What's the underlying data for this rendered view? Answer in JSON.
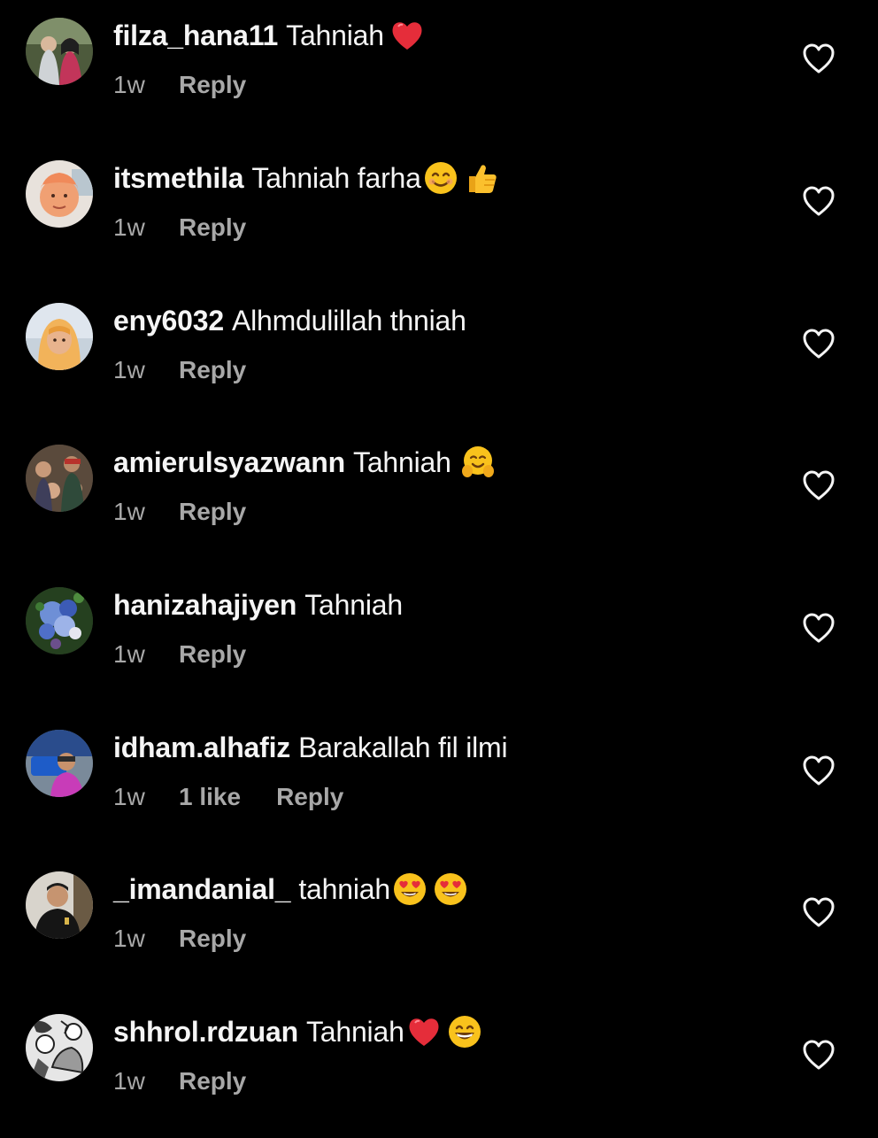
{
  "comments": [
    {
      "username": "filza_hana11",
      "text": "Tahniah",
      "emojis": [
        "red-heart"
      ],
      "time": "1w",
      "likes": "",
      "reply": "Reply"
    },
    {
      "username": "itsmethila",
      "text": "Tahniah farha",
      "emojis": [
        "smiling-face",
        "thumbs-up"
      ],
      "time": "1w",
      "likes": "",
      "reply": "Reply"
    },
    {
      "username": "eny6032",
      "text": "Alhmdulillah thniah",
      "emojis": [],
      "time": "1w",
      "likes": "",
      "reply": "Reply"
    },
    {
      "username": "amierulsyazwann",
      "text": "Tahniah",
      "emojis": [
        "hugging-face"
      ],
      "time": "1w",
      "likes": "",
      "reply": "Reply"
    },
    {
      "username": "hanizahajiyen",
      "text": "Tahniah",
      "emojis": [],
      "time": "1w",
      "likes": "",
      "reply": "Reply"
    },
    {
      "username": "idham.alhafiz",
      "text": "Barakallah fil ilmi",
      "emojis": [],
      "time": "1w",
      "likes": "1 like",
      "reply": "Reply"
    },
    {
      "username": "_imandanial_",
      "text": "tahniah",
      "emojis": [
        "heart-eyes",
        "heart-eyes"
      ],
      "time": "1w",
      "likes": "",
      "reply": "Reply"
    },
    {
      "username": "shhrol.rdzuan",
      "text": "Tahniah",
      "emojis": [
        "red-heart",
        "grinning-face"
      ],
      "time": "1w",
      "likes": "",
      "reply": "Reply"
    }
  ],
  "colors": {
    "background": "#000000",
    "primary_text": "#f5f5f5",
    "secondary_text": "#a8a8a8"
  }
}
